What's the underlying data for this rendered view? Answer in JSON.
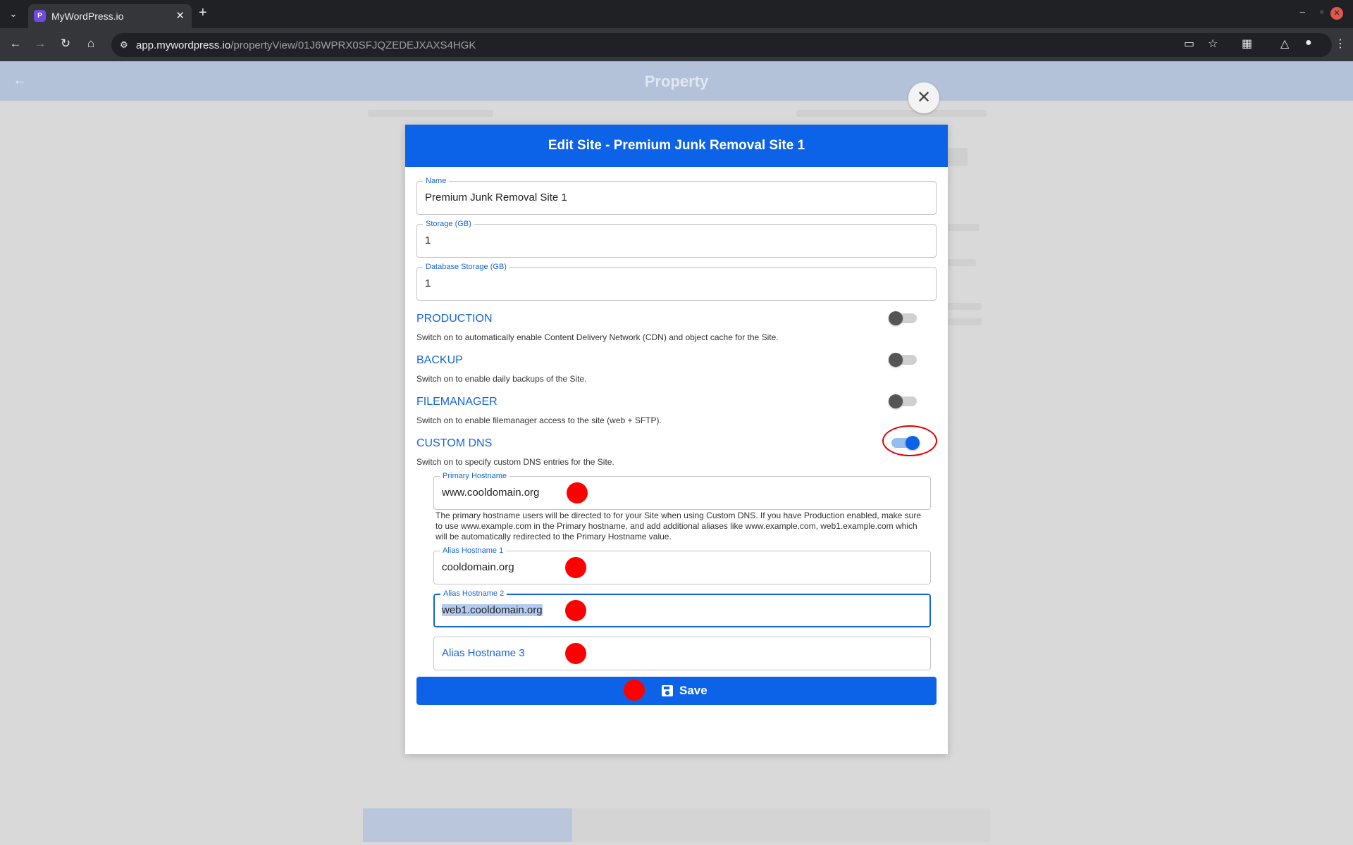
{
  "browser": {
    "tab_title": "MyWordPress.io",
    "tab_favicon": "mywordpress-favicon",
    "url_host": "app.mywordpress.io",
    "url_path": "/propertyView/01J6WPRX0SFJQZEDEJXAXS4HGK"
  },
  "page": {
    "title": "Property"
  },
  "modal": {
    "title": "Edit Site - Premium Junk Removal Site 1",
    "fields": {
      "name": {
        "label": "Name",
        "value": "Premium Junk Removal Site 1"
      },
      "storage": {
        "label": "Storage (GB)",
        "value": "1"
      },
      "db_storage": {
        "label": "Database Storage (GB)",
        "value": "1"
      }
    },
    "sections": {
      "production": {
        "title": "PRODUCTION",
        "desc": "Switch on to automatically enable Content Delivery Network (CDN) and object cache for the Site.",
        "enabled": false
      },
      "backup": {
        "title": "BACKUP",
        "desc": "Switch on to enable daily backups of the Site.",
        "enabled": false
      },
      "filemanager": {
        "title": "FILEMANAGER",
        "desc": "Switch on to enable filemanager access to the site (web + SFTP).",
        "enabled": false
      },
      "custom_dns": {
        "title": "CUSTOM DNS",
        "desc": "Switch on to specify custom DNS entries for the Site.",
        "enabled": true
      }
    },
    "dns": {
      "primary": {
        "label": "Primary Hostname",
        "value": "www.cooldomain.org"
      },
      "help": "The primary hostname users will be directed to for your Site when using Custom DNS.  If you have Production enabled, make sure to use www.example.com in the Primary hostname, and add additional aliases like www.example.com, web1.example.com which will be automatically redirected to the Primary Hostname value.",
      "alias1": {
        "label": "Alias Hostname 1",
        "value": "cooldomain.org"
      },
      "alias2": {
        "label": "Alias Hostname 2",
        "value": "web1.cooldomain.org"
      },
      "alias3": {
        "placeholder": "Alias Hostname 3"
      }
    },
    "save_label": "Save",
    "colors": {
      "primary": "#0d63e8",
      "marker": "#ff0000"
    }
  }
}
